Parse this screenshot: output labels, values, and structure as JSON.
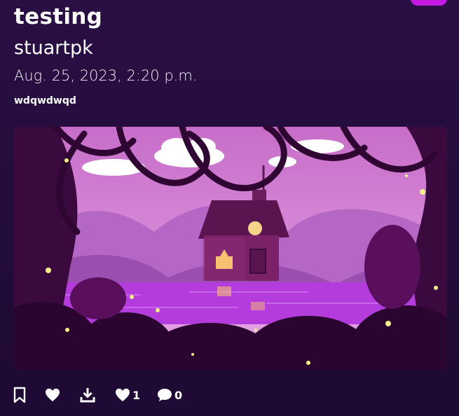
{
  "post": {
    "title": "testing",
    "author": "stuartpk",
    "date": "Aug. 25, 2023, 2:20 p.m.",
    "description": "wdqwdwqd"
  },
  "image": {
    "subject": "purple haunted forest cottage with fireflies",
    "colors": {
      "sky": "#d98ad9",
      "water": "#b43cdc",
      "foliage": "#3a0a3e",
      "firefly": "#f6f08a"
    }
  },
  "actions": {
    "bookmark_icon": "bookmark-icon",
    "favorite_icon": "heart-icon",
    "download_icon": "download-icon",
    "likes_icon": "heart-icon",
    "likes_count": "1",
    "comments_icon": "comment-icon",
    "comments_count": "0"
  },
  "accent": "#c21ae0"
}
